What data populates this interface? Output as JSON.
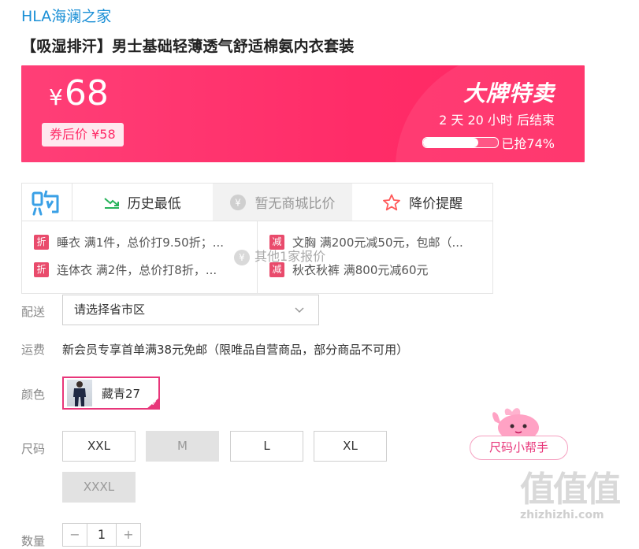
{
  "store": {
    "brand_link": "HLA海澜之家"
  },
  "product": {
    "title": "【吸湿排汗】男士基础轻薄透气舒适棉氨内衣套装"
  },
  "price_banner": {
    "currency": "¥",
    "price": "68",
    "coupon_label": "券后价 ¥58",
    "sale_badge": "大牌特卖",
    "countdown": "2  天 20 小时 后结束",
    "progress": 0.74,
    "progress_label": "已抢74%"
  },
  "compare": {
    "logo_icon": "gou-icon",
    "tabs": [
      {
        "label": "历史最低",
        "icon": "trend-down-icon"
      },
      {
        "label": "暂无商城比价",
        "icon": "yen-circle-icon"
      },
      {
        "label": "降价提醒",
        "icon": "star-icon"
      }
    ],
    "promos_left": [
      {
        "tag": "折",
        "text": "睡衣 满1件，总价打9.50折；..."
      },
      {
        "tag": "折",
        "text": "连体衣 满2件，总价打8折，..."
      }
    ],
    "promos_right": [
      {
        "tag": "减",
        "text": "文胸 满200元减50元，包邮（..."
      },
      {
        "tag": "减",
        "text": "秋衣秋裤 满800元减60元"
      }
    ],
    "overlay": "其他1家报价"
  },
  "delivery": {
    "label": "配送",
    "placeholder": "请选择省市区"
  },
  "shipping": {
    "label": "运费",
    "text": "新会员专享首单满38元免邮（限唯品自营商品，部分商品不可用）"
  },
  "color": {
    "label": "颜色",
    "selected": "藏青27"
  },
  "size": {
    "label": "尺码",
    "options": [
      {
        "label": "XXL",
        "disabled": false
      },
      {
        "label": "M",
        "disabled": true
      },
      {
        "label": "L",
        "disabled": false
      },
      {
        "label": "XL",
        "disabled": false
      },
      {
        "label": "XXXL",
        "disabled": true
      }
    ],
    "helper_button": "尺码小帮手"
  },
  "quantity": {
    "label": "数量",
    "minus": "−",
    "value": "1",
    "plus": "+"
  },
  "watermark": {
    "big": "值值值",
    "small": "zhizhizhi.com"
  },
  "colors": {
    "accent": "#ff2c68",
    "link": "#1a8fd6",
    "tag": "#e94b6c"
  }
}
